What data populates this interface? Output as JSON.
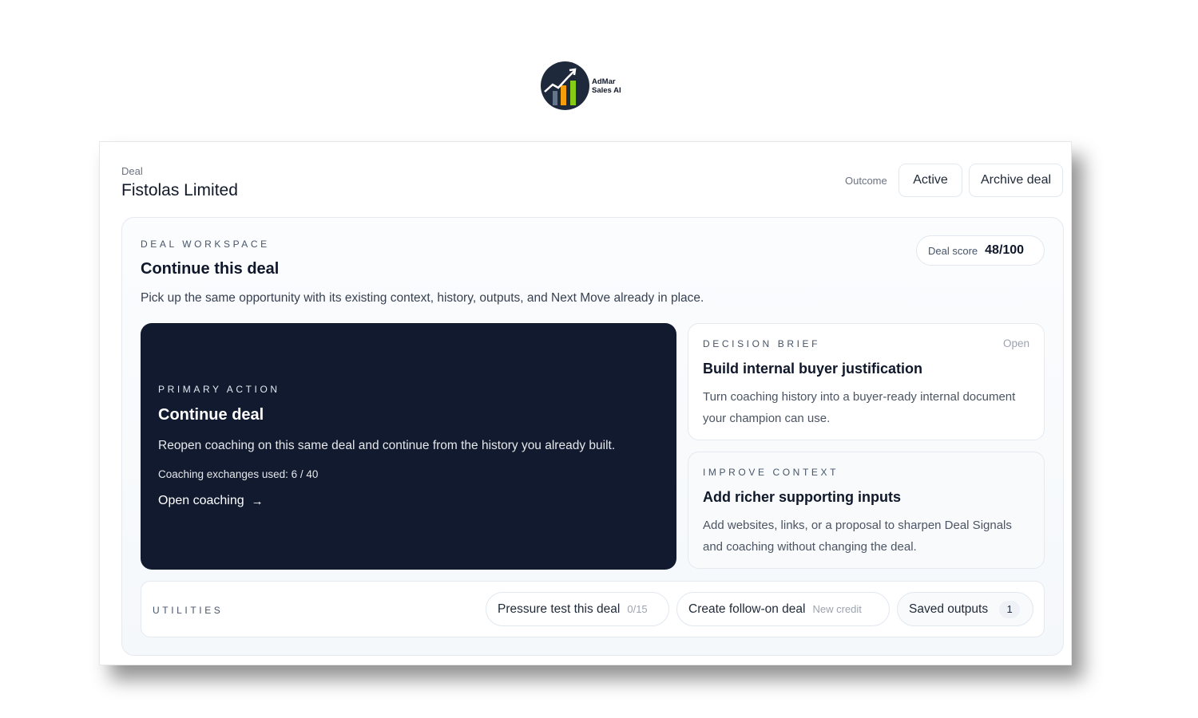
{
  "brand": {
    "name_line1": "AdMar",
    "name_line2": "Sales AI"
  },
  "header": {
    "deal_label": "Deal",
    "deal_title": "Fistolas Limited",
    "outcome_label": "Outcome",
    "outcome_value": "Active",
    "archive_label": "Archive deal"
  },
  "workspace": {
    "eyebrow": "Deal workspace",
    "title": "Continue this deal",
    "description": "Pick up the same opportunity with its existing context, history, outputs, and Next Move already in place.",
    "score_label": "Deal score",
    "score_value": "48/100"
  },
  "primary_action": {
    "eyebrow": "Primary action",
    "title": "Continue deal",
    "description": "Reopen coaching on this same deal and continue from the history you already built.",
    "usage": "Coaching exchanges used: 6 / 40",
    "link_label": "Open coaching",
    "link_icon": "arrow-right-icon"
  },
  "decision_brief": {
    "eyebrow": "Decision brief",
    "status": "Open",
    "title": "Build internal buyer justification",
    "description": "Turn coaching history into a buyer-ready internal document your champion can use."
  },
  "improve_context": {
    "eyebrow": "Improve context",
    "title": "Add richer supporting inputs",
    "description": "Add websites, links, or a proposal to sharpen Deal Signals and coaching without changing the deal."
  },
  "utilities": {
    "eyebrow": "Utilities",
    "pressure_label": "Pressure test this deal",
    "pressure_meta": "0/15",
    "followon_label": "Create follow-on deal",
    "followon_meta": "New credit",
    "saved_label": "Saved outputs",
    "saved_count": "1"
  },
  "colors": {
    "primary_card_bg": "#111a2e",
    "page_bg": "#ffffff",
    "logo_orange": "#f59e0b",
    "logo_green": "#84cc16"
  }
}
